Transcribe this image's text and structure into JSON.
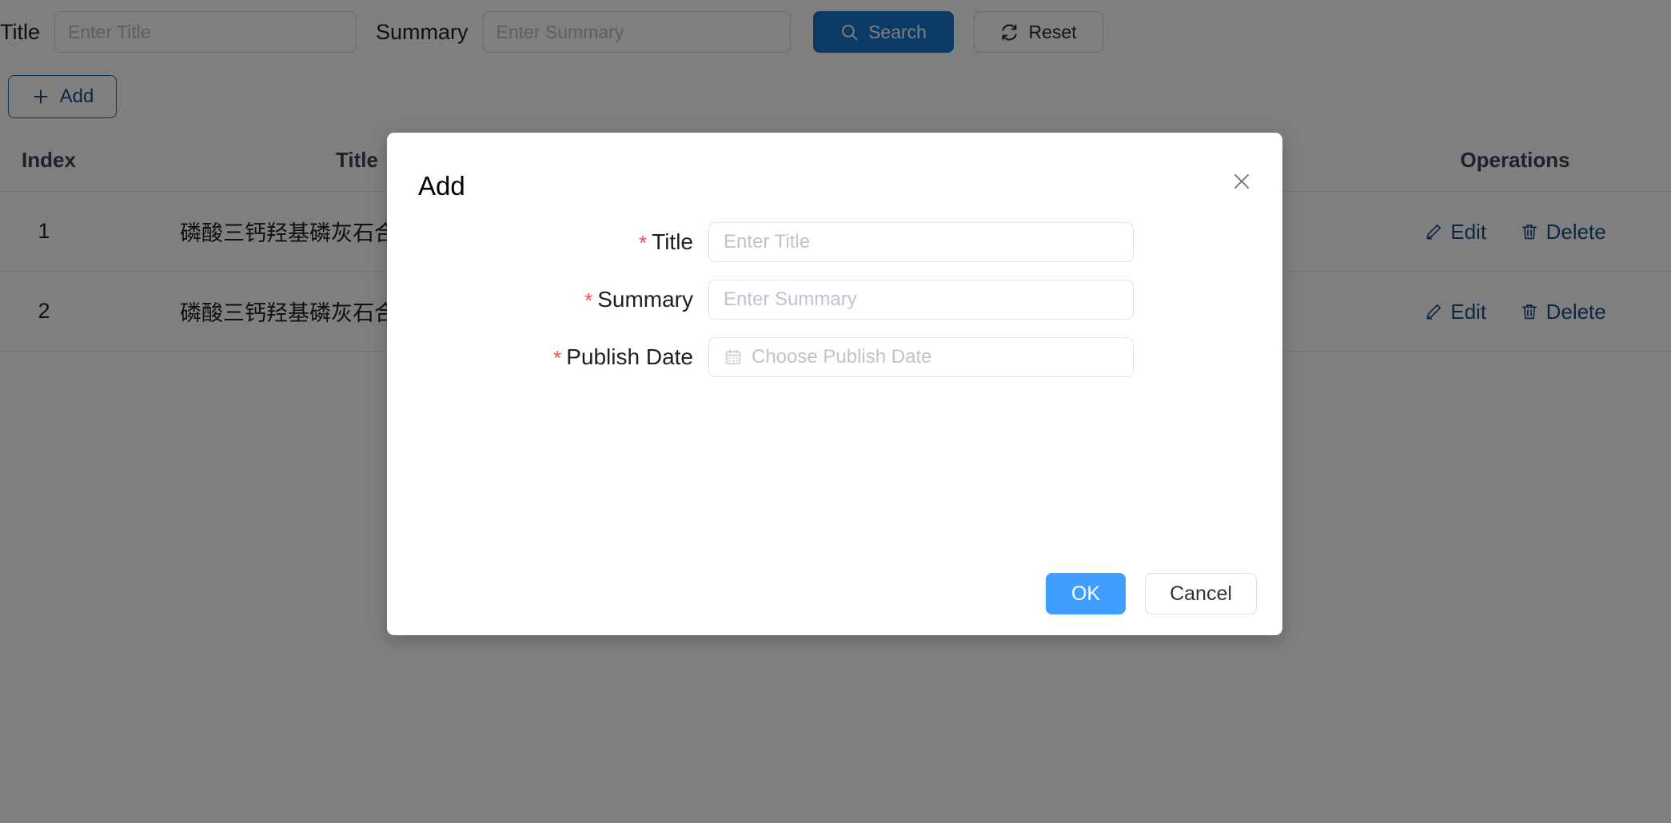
{
  "toolbar": {
    "title_label": "Title",
    "title_placeholder": "Enter Title",
    "title_value": "",
    "summary_label": "Summary",
    "summary_placeholder": "Enter Summary",
    "summary_value": "",
    "search_label": "Search",
    "reset_label": "Reset",
    "search_icon": "search-icon",
    "reset_icon": "refresh-icon",
    "primary_color": "#1890ff"
  },
  "actions": {
    "add_label": "Add",
    "add_icon": "plus-icon"
  },
  "table": {
    "columns": [
      {
        "key": "index",
        "label": "Index"
      },
      {
        "key": "title",
        "label": "Title"
      },
      {
        "key": "operations",
        "label": "Operations"
      }
    ],
    "rows": [
      {
        "index": "1",
        "title": "磷酸三钙羟基磷灰石合成材料",
        "edit_label": "Edit",
        "delete_label": "Delete",
        "edit_icon": "pencil-icon",
        "delete_icon": "trash-icon"
      },
      {
        "index": "2",
        "title": "磷酸三钙羟基磷灰石合成材料",
        "edit_label": "Edit",
        "delete_label": "Delete",
        "edit_icon": "pencil-icon",
        "delete_icon": "trash-icon"
      }
    ],
    "link_color": "#1a5490"
  },
  "modal": {
    "title": "Add",
    "close_icon": "close-icon",
    "fields": [
      {
        "required_mark": "*",
        "label": "Title",
        "placeholder": "Enter Title",
        "value": "",
        "icon": ""
      },
      {
        "required_mark": "*",
        "label": "Summary",
        "placeholder": "Enter Summary",
        "value": "",
        "icon": ""
      },
      {
        "required_mark": "*",
        "label": "Publish Date",
        "placeholder": "Choose Publish Date",
        "value": "",
        "icon": "calendar-icon"
      }
    ],
    "ok_label": "OK",
    "cancel_label": "Cancel",
    "ok_color": "#409eff"
  }
}
